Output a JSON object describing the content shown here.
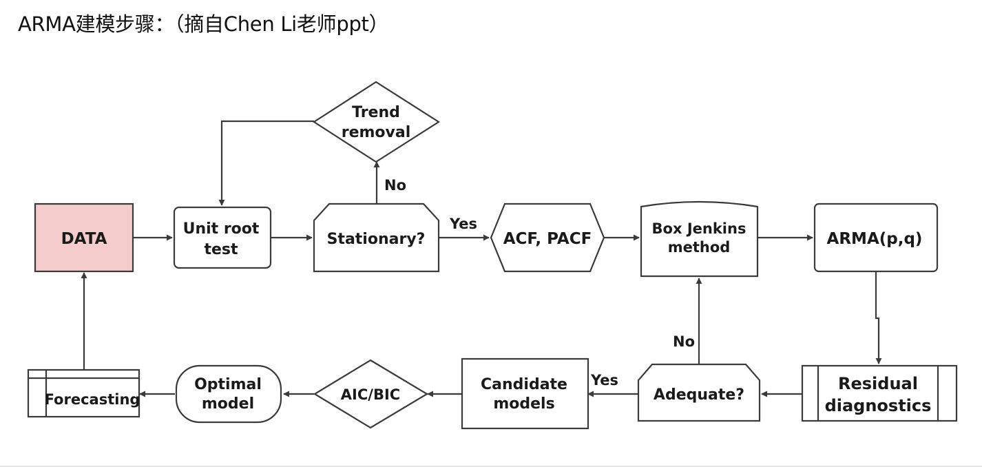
{
  "heading": "ARMA建模步骤：（摘自Chen Li老师ppt）",
  "nodes": {
    "data": {
      "label": "DATA"
    },
    "unit_root": {
      "line1": "Unit root",
      "line2": "test"
    },
    "stationary": {
      "label": "Stationary?"
    },
    "trend_removal": {
      "line1": "Trend",
      "line2": "removal"
    },
    "acf_pacf": {
      "label": "ACF, PACF"
    },
    "box_jenkins": {
      "line1": "Box Jenkins",
      "line2": "method"
    },
    "arma": {
      "label": "ARMA(p,q)"
    },
    "residual": {
      "line1": "Residual",
      "line2": "diagnostics"
    },
    "adequate": {
      "label": "Adequate?"
    },
    "candidate": {
      "line1": "Candidate",
      "line2": "models"
    },
    "aic_bic": {
      "label": "AIC/BIC"
    },
    "optimal": {
      "line1": "Optimal",
      "line2": "model"
    },
    "forecasting": {
      "label": "Forecasting"
    }
  },
  "edge_labels": {
    "stationary_no": "No",
    "stationary_yes": "Yes",
    "adequate_no": "No",
    "adequate_yes": "Yes"
  },
  "colors": {
    "data_fill": "#f4cccc",
    "stroke": "#3a3a3a",
    "text": "#1a1a1a"
  }
}
